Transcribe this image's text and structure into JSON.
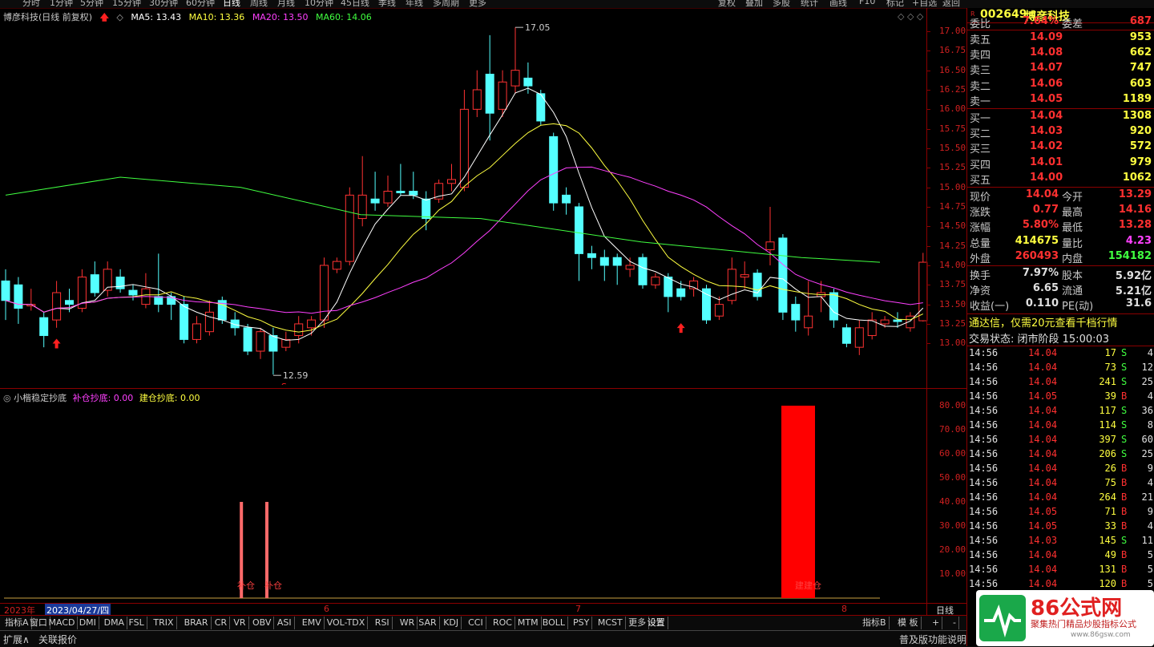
{
  "toolbar": {
    "periods": [
      "分时",
      "1分钟",
      "5分钟",
      "15分钟",
      "30分钟",
      "60分钟",
      "日线",
      "周线",
      "月线",
      "10分钟",
      "45日线",
      "季线",
      "年线",
      "多周期",
      "更多"
    ],
    "tools": [
      "复权",
      "叠加",
      "多股",
      "统计",
      "画线",
      "F10",
      "标记",
      "+自选",
      "返回"
    ]
  },
  "chart_header": {
    "stock": "博彦科技",
    "period_note": "(日线 前复权)",
    "ma5": "MA5: 13.43",
    "ma10": "MA10: 13.36",
    "ma20": "MA20: 13.50",
    "ma60": "MA60: 14.06",
    "colors": {
      "ma5": "#ffffff",
      "ma10": "#ffff40",
      "ma20": "#ff40ff",
      "ma60": "#40ff40"
    }
  },
  "price_axis": [
    "17.00",
    "16.75",
    "16.50",
    "16.25",
    "16.00",
    "15.75",
    "15.50",
    "15.25",
    "15.00",
    "14.75",
    "14.50",
    "14.25",
    "14.00",
    "13.75",
    "13.50",
    "13.25",
    "13.00"
  ],
  "annotations": {
    "high": "17.05",
    "low": "12.59",
    "s_mark": "S"
  },
  "indicator": {
    "title": "小楷稳定抄底",
    "buccang": "补仓抄底: 0.00",
    "jiancang": "建仓抄底: 0.00",
    "axis": [
      "80.00",
      "70.00",
      "60.00",
      "50.00",
      "40.00",
      "30.00",
      "20.00",
      "10.00"
    ],
    "bar_label_1": "补仓",
    "bar_label_2": "补仓",
    "bar_label_3": "建建仓"
  },
  "date_axis": {
    "year": "2023年",
    "cursor_date": "2023/04/27/四",
    "months": [
      "6",
      "7",
      "8"
    ],
    "period": "日线"
  },
  "tabs": [
    "指标A",
    "窗口",
    "MACD",
    "DMI",
    "DMA",
    "FSL",
    "TRIX",
    "BRAR",
    "CR",
    "VR",
    "OBV",
    "ASI",
    "EMV",
    "VOL-TDX",
    "RSI",
    "WR",
    "SAR",
    "KDJ",
    "CCI",
    "ROC",
    "MTM",
    "BOLL",
    "PSY",
    "MCST",
    "更多",
    "设置"
  ],
  "tabs_right": [
    "指标B",
    "模 板",
    "+",
    "-"
  ],
  "status": {
    "expand": "扩展∧",
    "link": "关联报价",
    "right": "普及版功能说明"
  },
  "quote": {
    "code": "002649",
    "name": "博彦科技",
    "weibi_label": "委比",
    "weibi": "7.64%",
    "weicha_label": "委差",
    "weicha": "687",
    "asks": [
      {
        "label": "卖五",
        "price": "14.09",
        "vol": "953"
      },
      {
        "label": "卖四",
        "price": "14.08",
        "vol": "662"
      },
      {
        "label": "卖三",
        "price": "14.07",
        "vol": "747"
      },
      {
        "label": "卖二",
        "price": "14.06",
        "vol": "603"
      },
      {
        "label": "卖一",
        "price": "14.05",
        "vol": "1189"
      }
    ],
    "bids": [
      {
        "label": "买一",
        "price": "14.04",
        "vol": "1308"
      },
      {
        "label": "买二",
        "price": "14.03",
        "vol": "920"
      },
      {
        "label": "买三",
        "price": "14.02",
        "vol": "572"
      },
      {
        "label": "买四",
        "price": "14.01",
        "vol": "979"
      },
      {
        "label": "买五",
        "price": "14.00",
        "vol": "1062"
      }
    ],
    "stats": [
      {
        "l1": "现价",
        "v1": "14.04",
        "l2": "今开",
        "v2": "13.29"
      },
      {
        "l1": "涨跌",
        "v1": "0.77",
        "l2": "最高",
        "v2": "14.16"
      },
      {
        "l1": "涨幅",
        "v1": "5.80%",
        "l2": "最低",
        "v2": "13.28"
      },
      {
        "l1": "总量",
        "v1": "414675",
        "l2": "量比",
        "v2": "4.23"
      },
      {
        "l1": "外盘",
        "v1": "260493",
        "l2": "内盘",
        "v2": "154182"
      }
    ],
    "stats2": [
      {
        "l1": "换手",
        "v1": "7.97%",
        "l2": "股本",
        "v2": "5.92亿"
      },
      {
        "l1": "净资",
        "v1": "6.65",
        "l2": "流通",
        "v2": "5.21亿"
      },
      {
        "l1": "收益(一)",
        "v1": "0.110",
        "l2": "PE(动)",
        "v2": "31.6"
      }
    ],
    "promo": "通达信，仅需20元查看千档行情",
    "trade_state": "交易状态: 闭市阶段 15:00:03",
    "ticks": [
      {
        "t": "14:56",
        "p": "14.04",
        "v": "17",
        "d": "S",
        "n": "4"
      },
      {
        "t": "14:56",
        "p": "14.04",
        "v": "73",
        "d": "S",
        "n": "12"
      },
      {
        "t": "14:56",
        "p": "14.04",
        "v": "241",
        "d": "S",
        "n": "25"
      },
      {
        "t": "14:56",
        "p": "14.05",
        "v": "39",
        "d": "B",
        "n": "4"
      },
      {
        "t": "14:56",
        "p": "14.04",
        "v": "117",
        "d": "S",
        "n": "36"
      },
      {
        "t": "14:56",
        "p": "14.04",
        "v": "114",
        "d": "S",
        "n": "8"
      },
      {
        "t": "14:56",
        "p": "14.04",
        "v": "397",
        "d": "S",
        "n": "60"
      },
      {
        "t": "14:56",
        "p": "14.04",
        "v": "206",
        "d": "S",
        "n": "25"
      },
      {
        "t": "14:56",
        "p": "14.04",
        "v": "26",
        "d": "B",
        "n": "9"
      },
      {
        "t": "14:56",
        "p": "14.04",
        "v": "75",
        "d": "B",
        "n": "4"
      },
      {
        "t": "14:56",
        "p": "14.04",
        "v": "264",
        "d": "B",
        "n": "21"
      },
      {
        "t": "14:56",
        "p": "14.05",
        "v": "71",
        "d": "B",
        "n": "9"
      },
      {
        "t": "14:56",
        "p": "14.05",
        "v": "33",
        "d": "B",
        "n": "4"
      },
      {
        "t": "14:56",
        "p": "14.03",
        "v": "145",
        "d": "S",
        "n": "11"
      },
      {
        "t": "14:56",
        "p": "14.04",
        "v": "49",
        "d": "B",
        "n": "5"
      },
      {
        "t": "14:56",
        "p": "14.04",
        "v": "131",
        "d": "B",
        "n": "5"
      },
      {
        "t": "14:56",
        "p": "14.04",
        "v": "120",
        "d": "B",
        "n": "5"
      }
    ]
  },
  "watermark": {
    "brand": "86公式网",
    "sub": "聚集热门精品炒股指标公式",
    "url": "www.86gsw.com"
  },
  "chart_data": {
    "type": "candlestick",
    "price_range": [
      12.85,
      17.1
    ],
    "candles": [
      {
        "o": 13.8,
        "c": 13.55,
        "h": 13.95,
        "l": 13.3
      },
      {
        "o": 13.75,
        "c": 13.45,
        "h": 13.85,
        "l": 13.25
      },
      {
        "o": 13.48,
        "c": 13.5,
        "h": 13.7,
        "l": 13.42
      },
      {
        "o": 13.33,
        "c": 13.1,
        "h": 13.4,
        "l": 12.95
      },
      {
        "o": 13.3,
        "c": 13.65,
        "h": 13.8,
        "l": 13.2
      },
      {
        "o": 13.55,
        "c": 13.5,
        "h": 13.7,
        "l": 13.4
      },
      {
        "o": 13.45,
        "c": 13.85,
        "h": 13.95,
        "l": 13.4
      },
      {
        "o": 13.88,
        "c": 13.65,
        "h": 14.05,
        "l": 13.6
      },
      {
        "o": 13.68,
        "c": 13.95,
        "h": 14.05,
        "l": 13.6
      },
      {
        "o": 13.85,
        "c": 13.7,
        "h": 13.95,
        "l": 13.65
      },
      {
        "o": 13.68,
        "c": 13.62,
        "h": 13.75,
        "l": 13.55
      },
      {
        "o": 13.5,
        "c": 13.7,
        "h": 13.9,
        "l": 13.45
      },
      {
        "o": 13.6,
        "c": 13.5,
        "h": 14.15,
        "l": 13.4
      },
      {
        "o": 13.6,
        "c": 13.5,
        "h": 13.65,
        "l": 13.3
      },
      {
        "o": 13.5,
        "c": 13.05,
        "h": 13.6,
        "l": 13.0
      },
      {
        "o": 13.05,
        "c": 13.25,
        "h": 13.35,
        "l": 13.0
      },
      {
        "o": 13.15,
        "c": 13.4,
        "h": 13.55,
        "l": 13.1
      },
      {
        "o": 13.55,
        "c": 13.3,
        "h": 13.6,
        "l": 13.25
      },
      {
        "o": 13.3,
        "c": 13.2,
        "h": 13.4,
        "l": 13.1
      },
      {
        "o": 13.2,
        "c": 12.9,
        "h": 13.25,
        "l": 12.85
      },
      {
        "o": 12.9,
        "c": 13.15,
        "h": 13.2,
        "l": 12.8
      },
      {
        "o": 13.1,
        "c": 12.9,
        "h": 13.2,
        "l": 12.6
      },
      {
        "o": 12.95,
        "c": 13.05,
        "h": 13.15,
        "l": 12.9
      },
      {
        "o": 13.1,
        "c": 13.25,
        "h": 13.35,
        "l": 13.0
      },
      {
        "o": 13.2,
        "c": 13.3,
        "h": 13.35,
        "l": 13.1
      },
      {
        "o": 13.3,
        "c": 14.0,
        "h": 14.1,
        "l": 13.2
      },
      {
        "o": 13.95,
        "c": 14.05,
        "h": 14.1,
        "l": 13.9
      },
      {
        "o": 14.05,
        "c": 14.9,
        "h": 15.0,
        "l": 14.0
      },
      {
        "o": 14.6,
        "c": 14.9,
        "h": 15.4,
        "l": 14.5
      },
      {
        "o": 14.85,
        "c": 14.8,
        "h": 15.2,
        "l": 14.7
      },
      {
        "o": 14.8,
        "c": 14.95,
        "h": 15.15,
        "l": 14.75
      },
      {
        "o": 14.95,
        "c": 14.93,
        "h": 15.3,
        "l": 14.9
      },
      {
        "o": 14.95,
        "c": 14.9,
        "h": 15.2,
        "l": 14.85
      },
      {
        "o": 14.85,
        "c": 14.6,
        "h": 14.95,
        "l": 14.45
      },
      {
        "o": 14.85,
        "c": 15.05,
        "h": 15.1,
        "l": 14.8
      },
      {
        "o": 15.05,
        "c": 15.1,
        "h": 15.3,
        "l": 14.95
      },
      {
        "o": 15.0,
        "c": 16.0,
        "h": 16.25,
        "l": 14.95
      },
      {
        "o": 16.0,
        "c": 16.25,
        "h": 16.5,
        "l": 15.9
      },
      {
        "o": 16.45,
        "c": 15.95,
        "h": 16.95,
        "l": 15.6
      },
      {
        "o": 16.0,
        "c": 16.35,
        "h": 16.5,
        "l": 15.9
      },
      {
        "o": 16.3,
        "c": 16.5,
        "h": 17.05,
        "l": 16.2
      },
      {
        "o": 16.4,
        "c": 16.3,
        "h": 16.6,
        "l": 16.2
      },
      {
        "o": 16.2,
        "c": 15.85,
        "h": 16.25,
        "l": 15.8
      },
      {
        "o": 15.65,
        "c": 14.8,
        "h": 15.7,
        "l": 14.7
      },
      {
        "o": 14.9,
        "c": 14.8,
        "h": 15.0,
        "l": 14.65
      },
      {
        "o": 14.75,
        "c": 14.15,
        "h": 14.8,
        "l": 13.8
      },
      {
        "o": 14.15,
        "c": 14.1,
        "h": 14.25,
        "l": 13.95
      },
      {
        "o": 14.1,
        "c": 14.0,
        "h": 14.2,
        "l": 13.8
      },
      {
        "o": 14.1,
        "c": 14.0,
        "h": 14.15,
        "l": 13.75
      },
      {
        "o": 13.95,
        "c": 14.0,
        "h": 14.1,
        "l": 13.85
      },
      {
        "o": 14.1,
        "c": 13.75,
        "h": 14.15,
        "l": 13.7
      },
      {
        "o": 13.75,
        "c": 13.85,
        "h": 13.9,
        "l": 13.7
      },
      {
        "o": 13.85,
        "c": 13.6,
        "h": 13.9,
        "l": 13.4
      },
      {
        "o": 13.7,
        "c": 13.6,
        "h": 13.8,
        "l": 13.55
      },
      {
        "o": 13.7,
        "c": 13.8,
        "h": 13.85,
        "l": 13.6
      },
      {
        "o": 13.7,
        "c": 13.3,
        "h": 13.75,
        "l": 13.25
      },
      {
        "o": 13.35,
        "c": 13.5,
        "h": 13.6,
        "l": 13.3
      },
      {
        "o": 13.55,
        "c": 13.95,
        "h": 14.1,
        "l": 13.5
      },
      {
        "o": 13.85,
        "c": 13.88,
        "h": 14.05,
        "l": 13.7
      },
      {
        "o": 13.9,
        "c": 13.6,
        "h": 13.95,
        "l": 13.55
      },
      {
        "o": 14.2,
        "c": 14.3,
        "h": 14.75,
        "l": 14.0
      },
      {
        "o": 14.35,
        "c": 13.4,
        "h": 14.4,
        "l": 13.3
      },
      {
        "o": 13.5,
        "c": 13.3,
        "h": 13.6,
        "l": 13.15
      },
      {
        "o": 13.2,
        "c": 13.35,
        "h": 13.8,
        "l": 13.1
      },
      {
        "o": 13.6,
        "c": 13.65,
        "h": 13.8,
        "l": 13.4
      },
      {
        "o": 13.65,
        "c": 13.3,
        "h": 13.7,
        "l": 13.2
      },
      {
        "o": 13.2,
        "c": 13.0,
        "h": 13.25,
        "l": 12.95
      },
      {
        "o": 12.95,
        "c": 13.2,
        "h": 13.3,
        "l": 12.85
      },
      {
        "o": 13.1,
        "c": 13.3,
        "h": 13.4,
        "l": 13.05
      },
      {
        "o": 13.25,
        "c": 13.3,
        "h": 13.35,
        "l": 13.2
      },
      {
        "o": 13.3,
        "c": 13.28,
        "h": 13.4,
        "l": 13.2
      },
      {
        "o": 13.2,
        "c": 13.35,
        "h": 13.4,
        "l": 13.15
      },
      {
        "o": 13.29,
        "c": 14.04,
        "h": 14.16,
        "l": 13.28
      }
    ],
    "indicator_bars": [
      {
        "index": 18,
        "value": 40
      },
      {
        "index": 20,
        "value": 40
      },
      {
        "index": 61,
        "value": 80,
        "wide": true
      }
    ]
  }
}
